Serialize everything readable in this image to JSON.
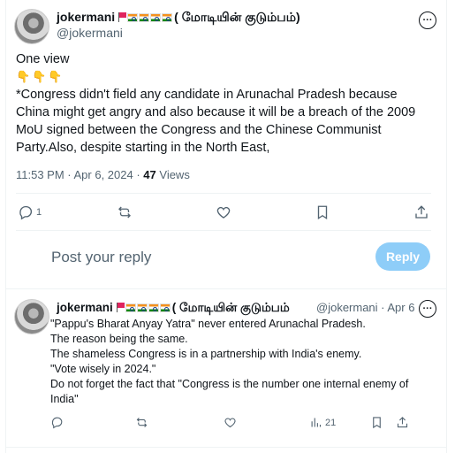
{
  "tweet": {
    "name": "jokermani",
    "tamil_suffix": "( மோடியின் குடும்பம்)",
    "handle": "@jokermani",
    "more_label": "···",
    "line1": "One view",
    "emoji": "👇👇👇",
    "body_lines": [
      "*Congress didn't field any candidate in Arunachal Pradesh because",
      "China might get angry  and also because it will be a breach of the 2009",
      "MoU signed between the Congress and the Chinese Communist",
      "Party.Also, despite starting in the North East,"
    ],
    "time": "11:53 PM · Apr 6, 2024 · ",
    "views_count": "47",
    "views_label": " Views",
    "reply_count": "1"
  },
  "reply_box": {
    "placeholder": "Post your reply",
    "button_label": "Reply"
  },
  "reply": {
    "name": "jokermani",
    "tamil_suffix": "( மோடியின் குடும்பம்",
    "handle": "@jokermani · Apr 6",
    "body_lines": [
      "\"Pappu's Bharat Anyay Yatra\" never entered Arunachal Pradesh.",
      "The reason being the same.",
      "The shameless Congress is in a partnership  with India's enemy.",
      "\"Vote wisely in 2024.\"",
      "Do not forget the fact that \"Congress is the number one internal  enemy of",
      "India\""
    ],
    "views_count": "21"
  },
  "colors": {
    "accent": "#1d9bf0",
    "muted": "#536471",
    "reply_button": "#8ecdf8"
  }
}
